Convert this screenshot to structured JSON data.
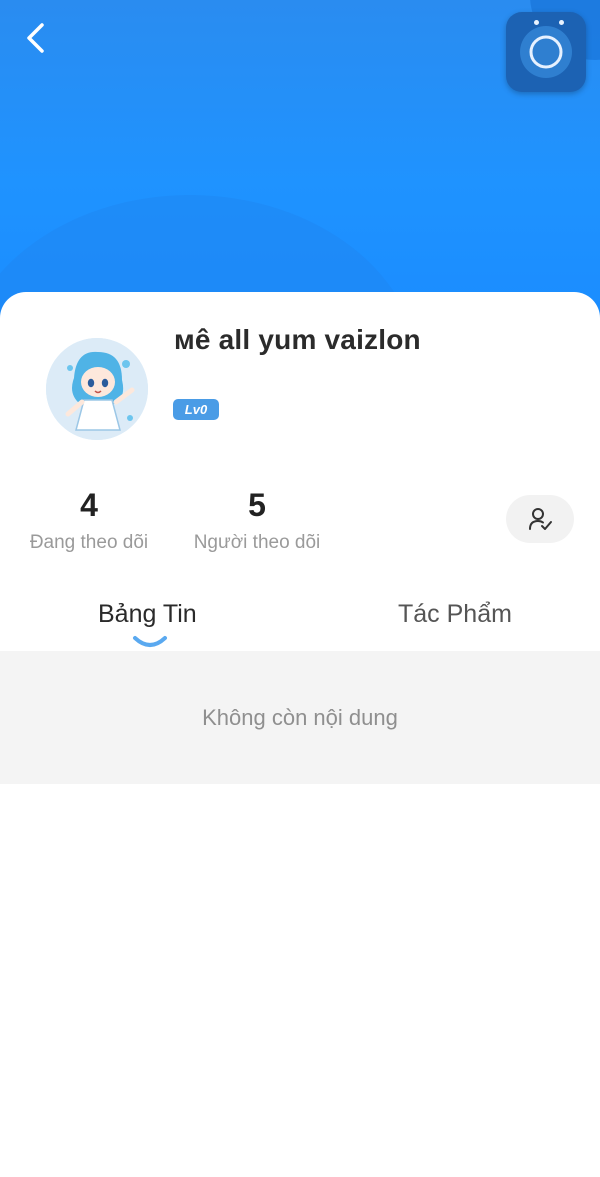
{
  "header": {
    "back_icon": "chevron-left-icon",
    "floating_button_icon": "assistive-touch-icon"
  },
  "profile": {
    "username": "ᴍê all yum vaizlon",
    "level": "Lv0",
    "avatar": "anime-character-avatar"
  },
  "stats": {
    "following": {
      "count": "4",
      "label": "Đang theo dõi"
    },
    "followers": {
      "count": "5",
      "label": "Người theo dõi"
    }
  },
  "follow_button_icon": "user-check-icon",
  "tabs": [
    {
      "label": "Bảng Tin",
      "active": true
    },
    {
      "label": "Tác Phẩm",
      "active": false
    }
  ],
  "content": {
    "empty_message": "Không còn nội dung"
  },
  "colors": {
    "header_blue": "#1f93ff",
    "badge_blue": "#4a9ce6",
    "indicator_blue": "#5aa9f0"
  }
}
